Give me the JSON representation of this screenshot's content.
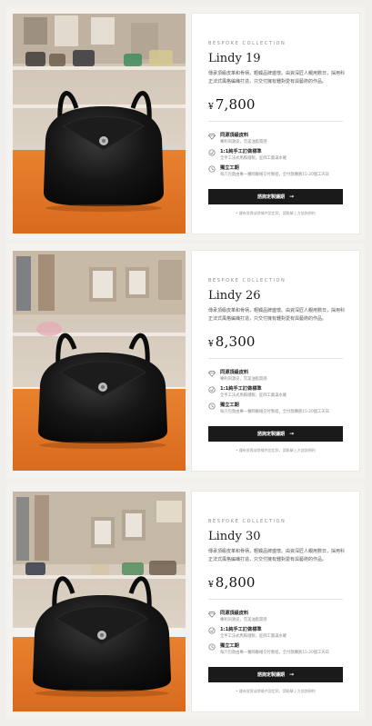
{
  "products": [
    {
      "eyebrow": "BESPOKE COLLECTION",
      "title": "Lindy 19",
      "desc": "傳承頂級皮革和骨柄，輕觸品牌盛懷。由資深匠人親用數日，採用科正法式風格編織打造，只交付擁有鍾對愛有與藝術的作品。",
      "currency": "¥",
      "price": "7,800",
      "features": [
        {
          "icon": "diamond-icon",
          "title": "同源頂級皮料",
          "sub": "專利同源皮，完美油脂質感"
        },
        {
          "icon": "stitch-icon",
          "title": "1:1純手工訂做標準",
          "sub": "全手工法式馬鞍縫製，匠師工藝滿水確"
        },
        {
          "icon": "clock-icon",
          "title": "獨立工期",
          "sub": "每只包款由專一審師聯絡交付製程，全付款購買15-20個工天日"
        }
      ],
      "button": "諮詢定製議期",
      "note": "• 鍾有欲實或帶條件說定款，請點擊上方諮詢預約"
    },
    {
      "eyebrow": "BESPOKE COLLECTION",
      "title": "Lindy 26",
      "desc": "傳承頂級皮革和骨柄，輕觸品牌盛懷。由資深匠人親用數日，採用科正法式風格編織打造，只交付擁有鍾對愛有與藝術的作品。",
      "currency": "¥",
      "price": "8,300",
      "features": [
        {
          "icon": "diamond-icon",
          "title": "同源頂級皮料",
          "sub": "專利同源皮，完美油脂質感"
        },
        {
          "icon": "stitch-icon",
          "title": "1:1純手工訂做標準",
          "sub": "全手工法式馬鞍縫製，匠師工藝滿水確"
        },
        {
          "icon": "clock-icon",
          "title": "獨立工期",
          "sub": "每只包款由專一審師聯絡交付製程，全付款購買15-20個工天日"
        }
      ],
      "button": "諮詢定製議期",
      "note": "• 鍾有欲實或帶條件說定款，請點擊上方諮詢預約"
    },
    {
      "eyebrow": "BESPOKE COLLECTION",
      "title": "Lindy 30",
      "desc": "傳承頂級皮革和骨柄，輕觸品牌盛懷。由資深匠人親用數日，採用科正法式風格編織打造，只交付擁有鍾對愛有與藝術的作品。",
      "currency": "¥",
      "price": "8,800",
      "features": [
        {
          "icon": "diamond-icon",
          "title": "同源頂級皮料",
          "sub": "專利同源皮，完美油脂質感"
        },
        {
          "icon": "stitch-icon",
          "title": "1:1純手工訂做標準",
          "sub": "全手工法式馬鞍縫製，匠師工藝滿水確"
        },
        {
          "icon": "clock-icon",
          "title": "獨立工期",
          "sub": "每只包款由專一審師聯絡交付製程，全付款購買15-20個工天日"
        }
      ],
      "button": "諮詢定製議期",
      "note": "• 鍾有欲實或帶條件說定款，請點擊上方諮詢預約"
    }
  ],
  "colors": {
    "page_bg": "#f1efec",
    "panel_bg": "#ffffff",
    "button_bg": "#1a1a1a",
    "table_orange": "#e0772a",
    "bag_black": "#111111"
  }
}
